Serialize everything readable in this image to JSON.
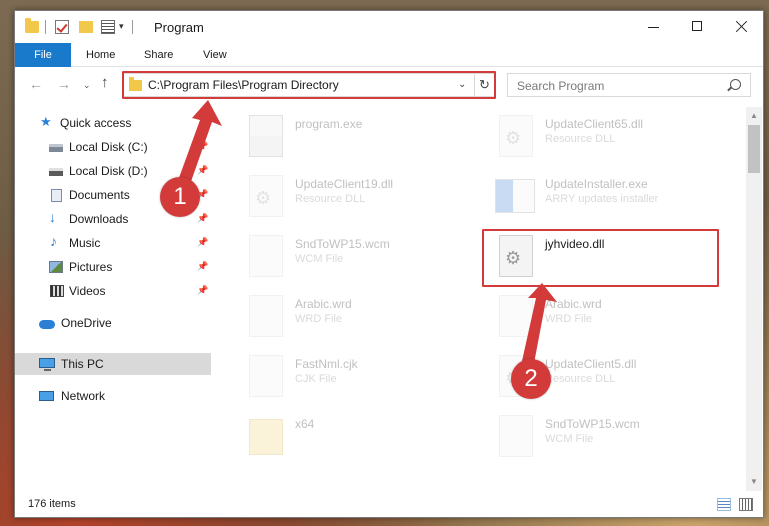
{
  "window": {
    "title": "Program",
    "controls": {
      "minimize": "—",
      "maximize": "☐",
      "close": "✕"
    }
  },
  "ribbon": {
    "tabs": [
      {
        "label": "File"
      },
      {
        "label": "Home"
      },
      {
        "label": "Share"
      },
      {
        "label": "View"
      }
    ]
  },
  "address": {
    "path": "C:\\Program Files\\Program Directory",
    "dropdown": "⌄",
    "refresh": "↻"
  },
  "search": {
    "placeholder": "Search Program"
  },
  "nav": {
    "back": "←",
    "forward": "→",
    "recent": "⌄",
    "up": "↑"
  },
  "sidebar": {
    "items": [
      {
        "label": "Quick access",
        "icon": "star-icon"
      },
      {
        "label": "Local Disk (C:)",
        "icon": "drive-icon",
        "pinned": true
      },
      {
        "label": "Local Disk (D:)",
        "icon": "drive-icon",
        "pinned": true
      },
      {
        "label": "Documents",
        "icon": "documents-icon",
        "pinned": true
      },
      {
        "label": "Downloads",
        "icon": "download-icon",
        "pinned": true
      },
      {
        "label": "Music",
        "icon": "music-icon",
        "pinned": true
      },
      {
        "label": "Pictures",
        "icon": "pictures-icon",
        "pinned": true
      },
      {
        "label": "Videos",
        "icon": "videos-icon",
        "pinned": true
      },
      {
        "label": "OneDrive",
        "icon": "cloud-icon"
      },
      {
        "label": "This PC",
        "icon": "computer-icon",
        "selected": true
      },
      {
        "label": "Network",
        "icon": "network-icon"
      }
    ],
    "pin_glyph": "📌"
  },
  "files": [
    {
      "name": "program.exe",
      "type": "",
      "icon": "program-icon",
      "faded": true
    },
    {
      "name": "UpdateClient65.dll",
      "type": "Resource DLL",
      "icon": "dll-icon",
      "faded": true
    },
    {
      "name": "UpdateClient19.dll",
      "type": "Resource DLL",
      "icon": "dll-icon",
      "faded": true
    },
    {
      "name": "UpdateInstaller.exe",
      "type": "ARRY updates installer",
      "icon": "installer-icon",
      "faded": true
    },
    {
      "name": "SndToWP15.wcm",
      "type": "WCM File",
      "icon": "file-icon",
      "faded": true
    },
    {
      "name": "jyhvideo.dll",
      "type": "",
      "icon": "dll-icon",
      "faded": false
    },
    {
      "name": "Arabic.wrd",
      "type": "WRD File",
      "icon": "file-icon",
      "faded": true
    },
    {
      "name": "Arabic.wrd",
      "type": "WRD File",
      "icon": "file-icon",
      "faded": true
    },
    {
      "name": "FastNml.cjk",
      "type": "CJK File",
      "icon": "file-icon",
      "faded": true
    },
    {
      "name": "UpdateClient5.dll",
      "type": "Resource DLL",
      "icon": "dll-icon",
      "faded": true
    },
    {
      "name": "x64",
      "type": "",
      "icon": "folder-icon",
      "faded": true
    },
    {
      "name": "SndToWP15.wcm",
      "type": "WCM File",
      "icon": "file-icon",
      "faded": true
    }
  ],
  "status": {
    "item_count": "176 items"
  },
  "annotations": {
    "callout_1": "1",
    "callout_2": "2",
    "color": "#d33b3b"
  },
  "colors": {
    "accent": "#1979ca",
    "selected": "#d9d9d9"
  }
}
